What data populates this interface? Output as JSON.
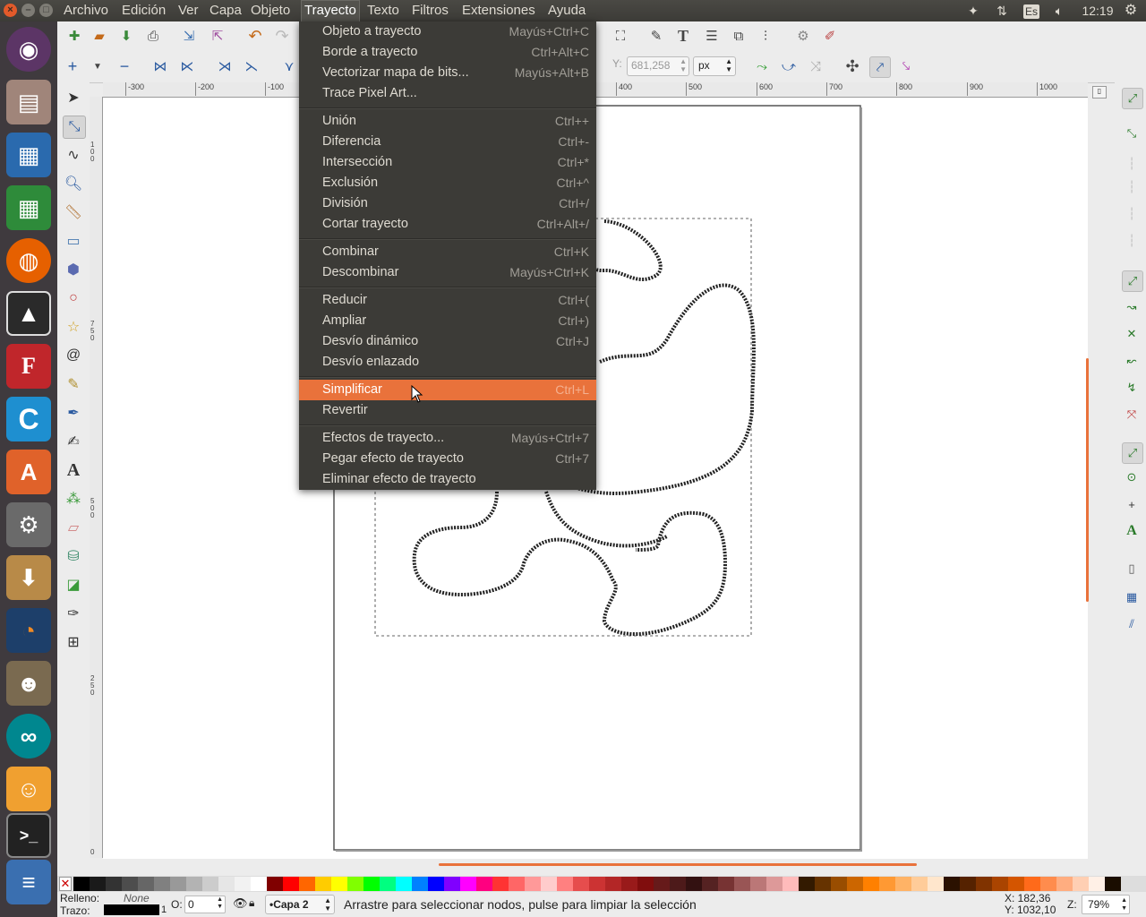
{
  "topbar": {
    "menus": [
      "Archivo",
      "Edición",
      "Ver",
      "Capa",
      "Objeto",
      "Trayecto",
      "Texto",
      "Filtros",
      "Extensiones",
      "Ayuda"
    ],
    "active_menu": "Trayecto",
    "keyboard_layout": "Es",
    "clock": "12:19"
  },
  "launcher": {
    "apps": [
      "ubuntu-dash-icon",
      "file-manager-icon",
      "libreoffice-writer-icon",
      "libreoffice-calc-icon",
      "firefox-icon",
      "inkscape-icon",
      "fritzing-icon",
      "c-ide-icon",
      "software-center-icon",
      "system-settings-icon",
      "archive-manager-icon",
      "blender-icon",
      "gimp-icon",
      "arduino-icon",
      "scratch-icon",
      "terminal-icon",
      "stack-icon"
    ]
  },
  "toolbar2": {
    "y_label": "Y:",
    "y_value": "681,258",
    "unit": "px"
  },
  "hruler": {
    "ticks": [
      "-300",
      "-200",
      "-100",
      "400",
      "500",
      "600",
      "700",
      "800",
      "900",
      "1000"
    ]
  },
  "vruler": {
    "ticks": [
      "100",
      "750",
      "500",
      "250",
      "0"
    ]
  },
  "dropdown": {
    "items": [
      {
        "label": "Objeto a trayecto",
        "accel": "Mayús+Ctrl+C"
      },
      {
        "label": "Borde a trayecto",
        "accel": "Ctrl+Alt+C"
      },
      {
        "label": "Vectorizar mapa de bits...",
        "accel": "Mayús+Alt+B"
      },
      {
        "label": "Trace Pixel Art...",
        "accel": ""
      },
      {
        "label": "Unión",
        "accel": "Ctrl++"
      },
      {
        "label": "Diferencia",
        "accel": "Ctrl+-"
      },
      {
        "label": "Intersección",
        "accel": "Ctrl+*"
      },
      {
        "label": "Exclusión",
        "accel": "Ctrl+^"
      },
      {
        "label": "División",
        "accel": "Ctrl+/"
      },
      {
        "label": "Cortar trayecto",
        "accel": "Ctrl+Alt+/"
      },
      {
        "label": "Combinar",
        "accel": "Ctrl+K"
      },
      {
        "label": "Descombinar",
        "accel": "Mayús+Ctrl+K"
      },
      {
        "label": "Reducir",
        "accel": "Ctrl+("
      },
      {
        "label": "Ampliar",
        "accel": "Ctrl+)"
      },
      {
        "label": "Desvío dinámico",
        "accel": "Ctrl+J"
      },
      {
        "label": "Desvío enlazado",
        "accel": ""
      },
      {
        "label": "Simplificar",
        "accel": "Ctrl+L"
      },
      {
        "label": "Revertir",
        "accel": ""
      },
      {
        "label": "Efectos de trayecto...",
        "accel": "Mayús+Ctrl+7"
      },
      {
        "label": "Pegar efecto de trayecto",
        "accel": "Ctrl+7"
      },
      {
        "label": "Eliminar efecto de trayecto",
        "accel": ""
      }
    ],
    "highlighted": "Simplificar"
  },
  "palette": {
    "colors": [
      "#000000",
      "#1a1a1a",
      "#333333",
      "#4d4d4d",
      "#666666",
      "#808080",
      "#999999",
      "#b3b3b3",
      "#cccccc",
      "#e6e6e6",
      "#f2f2f2",
      "#ffffff",
      "#800000",
      "#ff0000",
      "#ff6600",
      "#ffcc00",
      "#ffff00",
      "#80ff00",
      "#00ff00",
      "#00ff80",
      "#00ffff",
      "#0080ff",
      "#0000ff",
      "#8000ff",
      "#ff00ff",
      "#ff0080",
      "#ff3333",
      "#ff6666",
      "#ff9999",
      "#ffcccc",
      "#ff8080",
      "#e64d4d",
      "#cc3333",
      "#b32626",
      "#991a1a",
      "#800d0d",
      "#661a1a",
      "#4d1a1a",
      "#331111",
      "#552222",
      "#773333",
      "#995555",
      "#bb7777",
      "#dd9999",
      "#ffbbbb",
      "#331a00",
      "#663300",
      "#994d00",
      "#cc6600",
      "#ff8000",
      "#ff9933",
      "#ffb366",
      "#ffcc99",
      "#ffe6cc",
      "#2b1100",
      "#552200",
      "#803300",
      "#aa4400",
      "#d45500",
      "#ff6a1a",
      "#ff8c4d",
      "#ffad80",
      "#ffcfb3",
      "#fff0e6",
      "#1a0d00"
    ]
  },
  "statusbar": {
    "fill_label": "Relleno:",
    "fill_value": "None",
    "stroke_label": "Trazo:",
    "stroke_width": "1",
    "opacity_label": "O:",
    "opacity_value": "0",
    "layer": "•Capa 2",
    "message": "Arrastre para seleccionar nodos, pulse para limpiar la selección",
    "x_coord": "X:  182,36",
    "y_coord": "Y: 1032,10",
    "zoom_label": "Z:",
    "zoom_value": "79%"
  }
}
